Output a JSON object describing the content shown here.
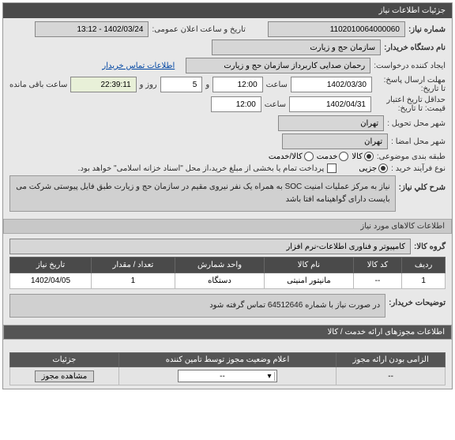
{
  "header": {
    "title": "جزئیات اطلاعات نیاز"
  },
  "top": {
    "need_no_label": "شماره نیاز:",
    "need_no": "1102010064000060",
    "pub_date_label": "تاریخ و ساعت اعلان عمومی:",
    "pub_date": "1402/03/24 - 13:12",
    "buyer_org_label": "نام دستگاه خریدار:",
    "buyer_org": "سازمان حج و زیارت",
    "requester_label": "ایجاد کننده درخواست:",
    "requester": "رحمان  صدایی کاربرداز سازمان حج و زیارت",
    "contact_link": "اطلاعات تماس خریدار",
    "reply_deadline_label": "مهلت ارسال پاسخ:",
    "reply_until": "تا تاریخ:",
    "reply_date": "1402/03/30",
    "hour_label": "ساعت",
    "reply_hour": "12:00",
    "and": "و",
    "reply_day": "5",
    "day_label": "روز و",
    "remain": "22:39:11",
    "remain_label": "ساعت باقی مانده",
    "min_valid_label": "حداقل تاریخ اعتبار",
    "price_until": "قیمت: تا تاریخ:",
    "valid_date": "1402/04/31",
    "valid_hour": "12:00",
    "delivery_loc_label": "شهر محل تحویل :",
    "delivery_loc": "تهران",
    "sign_loc_label": "شهر محل امضا :",
    "sign_loc": "تهران",
    "category_label": "طبقه بندی موضوعی:",
    "cat_goods": "کالا",
    "cat_service": "خدمت",
    "cat_service_goods": "کالا/خدمت",
    "buy_type_label": "نوع فرآیند خرید :",
    "buy_partial": "جزیی",
    "buy_note": "پرداخت تمام یا بخشی از مبلغ خرید،از محل \"اسناد خزانه اسلامی\" خواهد بود.",
    "need_desc_label": "شرح کلي نیاز:",
    "need_desc": "نیاز به مرکز عملیات امنیت SOC به همراه یک نفر نیروی مقیم در سازمان حج و زیارت طبق فایل پیوستی شرکت می بایست دارای گواهینامه افتا باشد"
  },
  "goods": {
    "title": "اطلاعات کالاهای مورد نیاز",
    "group_label": "گروه کالا:",
    "group_value": "کامپیوتر و فناوری اطلاعات-نرم افزار",
    "cols": {
      "row": "ردیف",
      "code": "کد کالا",
      "name": "نام کالا",
      "unit": "واحد شمارش",
      "qty": "تعداد / مقدار",
      "date": "تاریخ نیاز"
    },
    "items": [
      {
        "row": "1",
        "code": "--",
        "name": "مانیتور امنیتی",
        "unit": "دستگاه",
        "qty": "1",
        "date": "1402/04/05"
      }
    ],
    "buyer_notes_label": "توضیحات خریدار:",
    "buyer_notes": "در صورت نیاز با شماره 64512646 تماس گرفته شود"
  },
  "permits": {
    "title": "اطلاعات مجوزهای ارائه خدمت / کالا",
    "cols": {
      "mandatory": "الزامی بودن ارائه مجوز",
      "status": "اعلام وضعیت مجوز توسط تامین کننده",
      "details": "جزئیات"
    },
    "row": {
      "mandatory": "--",
      "status": "--",
      "details_btn": "مشاهده مجوز"
    }
  }
}
